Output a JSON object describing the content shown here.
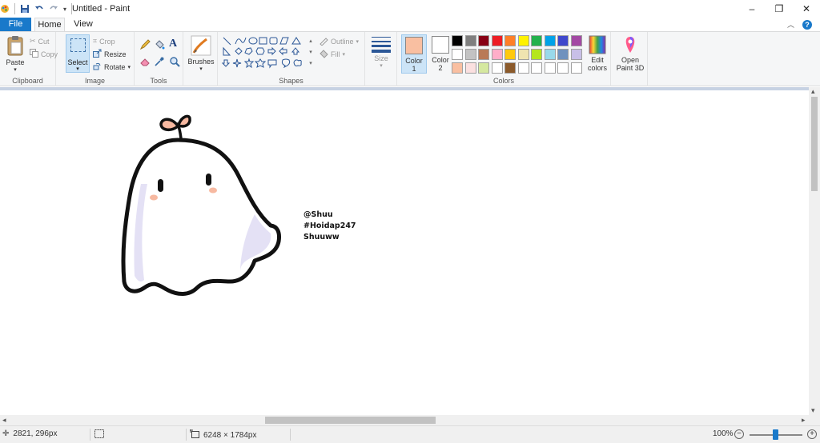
{
  "window": {
    "title": "Untitled - Paint",
    "minimize": "–",
    "restore": "❐",
    "close": "✕"
  },
  "tabs": {
    "file": "File",
    "home": "Home",
    "view": "View"
  },
  "ribbon": {
    "clipboard": {
      "label": "Clipboard",
      "paste": "Paste",
      "cut": "Cut",
      "copy": "Copy"
    },
    "image": {
      "label": "Image",
      "select": "Select",
      "crop": "Crop",
      "resize": "Resize",
      "rotate": "Rotate"
    },
    "tools": {
      "label": "Tools"
    },
    "brushes": {
      "label": "Brushes"
    },
    "shapes": {
      "label": "Shapes",
      "outline": "Outline",
      "fill": "Fill"
    },
    "size": {
      "label": "Size"
    },
    "colors": {
      "label": "Colors",
      "color1_line1": "Color",
      "color1_line2": "1",
      "color2_line1": "Color",
      "color2_line2": "2",
      "edit_line1": "Edit",
      "edit_line2": "colors",
      "color1_value": "#f9bfa1",
      "color2_value": "#ffffff",
      "palette_row1": [
        "#000000",
        "#7f7f7f",
        "#880015",
        "#ed1c24",
        "#ff7f27",
        "#fff200",
        "#22b14c",
        "#00a2e8",
        "#3f48cc",
        "#a349a4"
      ],
      "palette_row2": [
        "#ffffff",
        "#c3c3c3",
        "#b97a57",
        "#ffaec9",
        "#ffc90e",
        "#efe4b0",
        "#b5e61d",
        "#99d9ea",
        "#7092be",
        "#c8bfe7"
      ],
      "palette_row3": [
        "#f9bfa1",
        "#fbe0e0",
        "#d5e8a0",
        "#ffffff",
        "#8b5a2b",
        "#ffffff",
        "#ffffff",
        "#ffffff",
        "#ffffff",
        "#ffffff"
      ]
    },
    "paint3d": {
      "line1": "Open",
      "line2": "Paint 3D"
    }
  },
  "canvas": {
    "text_lines": [
      "@Shuu",
      "#Hoidap247",
      "Shuuww"
    ]
  },
  "status": {
    "cursor_pos": "2821, 296px",
    "image_size": "6248 × 1784px",
    "zoom": "100%",
    "zoom_level_percent": 100
  }
}
